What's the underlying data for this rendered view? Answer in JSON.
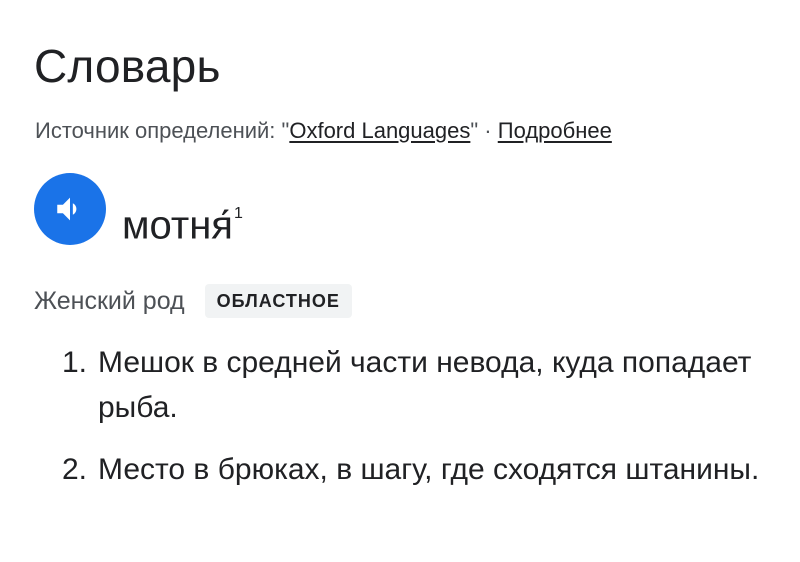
{
  "heading": "Словарь",
  "source_prefix": "Источник определений: \"",
  "source_link": "Oxford Languages",
  "source_suffix": "\" · ",
  "more_link": "Подробнее",
  "audio_icon": "speaker-icon",
  "accent_color": "#1a73e8",
  "headword": "мотня́",
  "headword_sup": "1",
  "part_of_speech": "Женский род",
  "usage_label": "ОБЛАСТНОЕ",
  "definitions": [
    {
      "num": "1.",
      "text": "Мешок в средней части невода, куда попадает рыба."
    },
    {
      "num": "2.",
      "text": "Место в брюках, в шагу, где сходятся штанины."
    }
  ]
}
